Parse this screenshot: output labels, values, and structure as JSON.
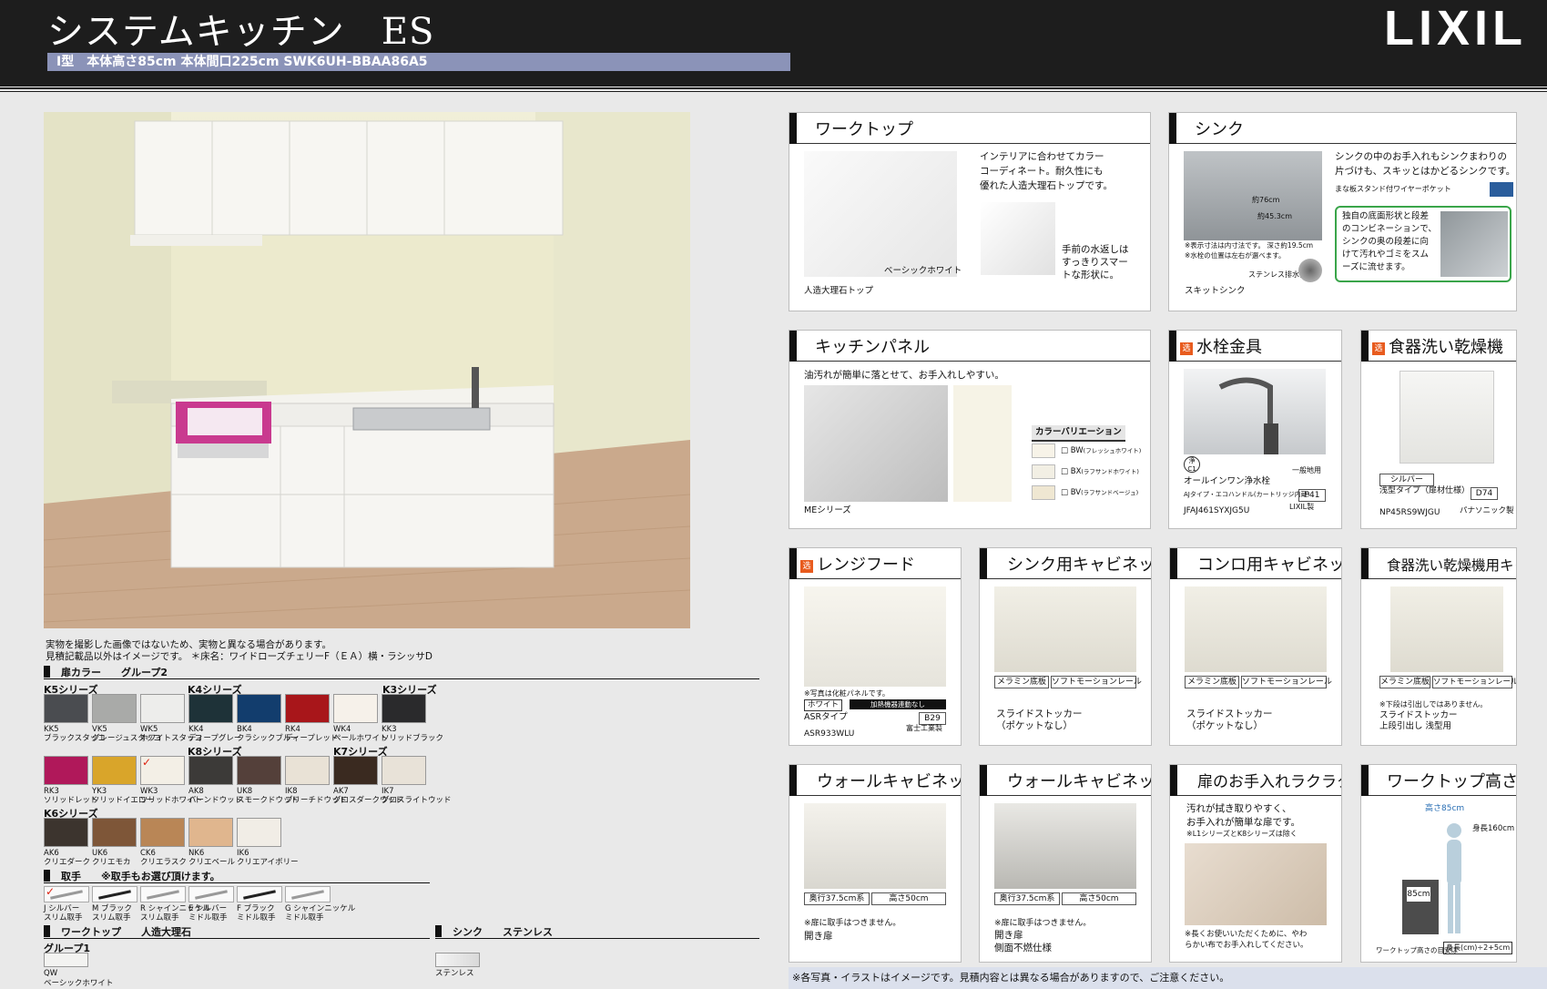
{
  "header": {
    "title_main": "システムキッチン",
    "title_series": "ES",
    "brand": "LIXIL",
    "spec": "Ⅰ型　本体高さ85cm 本体間口225cm SWK6UH-BBAA86A5"
  },
  "main_image": {
    "caption_1": "実物を撮影した画像ではないため、実物と異なる場合があります。",
    "caption_2": "見積記載品以外はイメージです。 ＊床名：ワイドローズチェリーF（ＥＡ）横・ラシッサD"
  },
  "door_color": {
    "label": "扉カラー",
    "group": "グループ2",
    "series_labels": {
      "k5": "K5シリーズ",
      "k4": "K4シリーズ",
      "k3": "K3シリーズ",
      "k8": "K8シリーズ",
      "k7": "K7シリーズ",
      "k6": "K6シリーズ"
    },
    "row1": [
      {
        "code": "KK5",
        "name": "ブラックスタッコ",
        "color": "#4a4c50"
      },
      {
        "code": "VK5",
        "name": "グレージュスタッコ",
        "color": "#a9aaa8"
      },
      {
        "code": "WK5",
        "name": "ホワイトスタッコ",
        "color": "#ededeb"
      },
      {
        "code": "KK4",
        "name": "ディープグレー",
        "color": "#1e3238"
      },
      {
        "code": "BK4",
        "name": "クラシックブルー",
        "color": "#123d6d"
      },
      {
        "code": "RK4",
        "name": "ディープレッド",
        "color": "#a8161a"
      },
      {
        "code": "WK4",
        "name": "ペールホワイト",
        "color": "#f6f1ea"
      },
      {
        "code": "KK3",
        "name": "ソリッドブラック",
        "color": "#2a2a2c"
      }
    ],
    "row2": [
      {
        "code": "RK3",
        "name": "ソリッドレッド",
        "color": "#b0185a"
      },
      {
        "code": "YK3",
        "name": "ソリッドイエロー",
        "color": "#d9a52a"
      },
      {
        "code": "WK3",
        "name": "ソリッドホワイト",
        "color": "#f3efe6"
      },
      {
        "code": "AK8",
        "name": "バーンドウッド",
        "color": "#3c3a38"
      },
      {
        "code": "UK8",
        "name": "スモークドウッド",
        "color": "#54403a"
      },
      {
        "code": "IK8",
        "name": "ブリーチドウッド",
        "color": "#e9e2d6"
      },
      {
        "code": "AK7",
        "name": "グロスダークウッド",
        "color": "#3a2a20"
      },
      {
        "code": "IK7",
        "name": "グロスライトウッド",
        "color": "#e8e2d8"
      }
    ],
    "row3": [
      {
        "code": "AK6",
        "name": "クリエダーク",
        "color": "#3c342e"
      },
      {
        "code": "UK6",
        "name": "クリエモカ",
        "color": "#7e5638"
      },
      {
        "code": "CK6",
        "name": "クリエラスク",
        "color": "#b98656"
      },
      {
        "code": "NK6",
        "name": "クリエベール",
        "color": "#e0b68e"
      },
      {
        "code": "IK6",
        "name": "クリエアイボリー",
        "color": "#f1ede6"
      }
    ]
  },
  "handle": {
    "label": "取手",
    "note": "※取手もお選び頂けます。",
    "items": [
      {
        "code": "J",
        "name1": "シルバー",
        "name2": "スリム取手"
      },
      {
        "code": "M",
        "name1": "ブラック",
        "name2": "スリム取手"
      },
      {
        "code": "R",
        "name1": "シャインニッケル",
        "name2": "スリム取手"
      },
      {
        "code": "E",
        "name1": "シルバー",
        "name2": "ミドル取手"
      },
      {
        "code": "F",
        "name1": "ブラック",
        "name2": "ミドル取手"
      },
      {
        "code": "G",
        "name1": "シャインニッケル",
        "name2": "ミドル取手"
      }
    ]
  },
  "worktop_sel": {
    "label": "ワークトップ",
    "material": "人造大理石",
    "group": "グループ1",
    "code": "QW",
    "name": "ベーシックホワイト"
  },
  "sink_sel": {
    "label": "シンク",
    "material": "ステンレス",
    "name": "ステンレス"
  },
  "cards": {
    "worktop": {
      "title": "ワークトップ",
      "desc": [
        "インテリアに合わせてカラー",
        "コーディネート。耐久性にも",
        "優れた人造大理石トップです。"
      ],
      "desc2": [
        "手前の水返しは",
        "すっきりスマー",
        "トな形状に。"
      ],
      "color_label": "ベーシックホワイト",
      "caption": "人造大理石トップ"
    },
    "sink": {
      "title": "シンク",
      "desc": [
        "シンクの中のお手入れもシンクまわりの",
        "片づけも、スキッとはかどるシンクです。"
      ],
      "stand": "まな板スタンド付ワイヤーポケット",
      "dim_w": "約76cm",
      "dim_d": "約45.3cm",
      "note1": "※表示寸法は内寸法です。 深さ約19.5cm",
      "note2": "※水栓の位置は左右が選べます。",
      "drain": "ステンレス排水口",
      "caption": "スキットシンク",
      "green": [
        "独自の底面形状と段差",
        "のコンビネーションで、",
        "シンクの奥の段差に向",
        "けて汚れやゴミをスム",
        "ーズに流せます。"
      ]
    },
    "panel": {
      "title": "キッチンパネル",
      "desc": "油汚れが簡単に落とせて、お手入れしやすい。",
      "variation": "カラーバリエーション",
      "colors": [
        {
          "code": "□ BW",
          "name": "(フレッシュホワイト)",
          "color": "#f7f3e8"
        },
        {
          "code": "□ BX",
          "name": "(ラフサンドホワイト)",
          "color": "#f2efe4"
        },
        {
          "code": "□ BV",
          "name": "(ラフサンドベージュ)",
          "color": "#efe7d2"
        }
      ],
      "caption": "MEシリーズ"
    },
    "faucet": {
      "title": "水栓金具",
      "badge": "浄",
      "badge_sub": "C1",
      "type": "一般地用",
      "name": "オールインワン浄水栓",
      "sub": "AJタイプ・エコハンドル(カートリッジ内蔵)",
      "page": "P41",
      "model": "JFAJ461SYXJG5U",
      "maker": "LIXIL製"
    },
    "dishwasher": {
      "title": "食器洗い乾燥機",
      "color": "シルバー",
      "type": "浅型タイプ（扉材仕様）",
      "page": "D74",
      "model": "NP45RS9WJGU",
      "maker": "パナソニック製"
    },
    "hood": {
      "title": "レンジフード",
      "note": "※写真は化粧パネルです。",
      "color": "ホワイト",
      "sub": "加熱機器連動なし",
      "type": "ASRタイプ",
      "page": "B29",
      "model": "ASR933WLU",
      "maker": "富士工業製"
    },
    "sink_cab": {
      "title": "シンク用キャビネット",
      "tag1": "メラミン底板",
      "tag2": "ソフトモーションレール",
      "line1": "スライドストッカー",
      "line2": "（ポケットなし）"
    },
    "stove_cab": {
      "title": "コンロ用キャビネット",
      "tag1": "メラミン底板",
      "tag2": "ソフトモーションレール",
      "line1": "スライドストッカー",
      "line2": "（ポケットなし）"
    },
    "dw_cab": {
      "title": "食器洗い乾燥機用キャビネット",
      "tag1": "メラミン底板",
      "tag2": "ソフトモーションレール",
      "note": "※下段は引出しではありません。",
      "line1": "スライドストッカー",
      "line2": "上段引出し 浅型用"
    },
    "wall_cab1": {
      "title": "ウォールキャビネット",
      "depth": "奥行37.5cm系",
      "height": "高さ50cm",
      "note": "※扉に取手はつきません。",
      "line1": "開き扉"
    },
    "wall_cab2": {
      "title": "ウォールキャビネット",
      "depth": "奥行37.5cm系",
      "height": "高さ50cm",
      "note": "※扉に取手はつきません。",
      "line1": "開き扉",
      "line2": "側面不燃仕様"
    },
    "door_care": {
      "title": "扉のお手入れラクラク",
      "desc1": "汚れが拭き取りやすく、",
      "desc2": "お手入れが簡単な扉です。",
      "desc3": "※L1シリーズとK8シリーズは除く",
      "note1": "※長くお使いいただくために、やわ",
      "note2": "らかい布でお手入れしてください。"
    },
    "height": {
      "title": "ワークトップ高さ",
      "value": "高さ85cm",
      "person": "身長160cm",
      "box": "85cm",
      "formula_label": "ワークトップ高さの目安は",
      "formula": "身長(cm)÷2+5cm"
    }
  },
  "footnote": "※各写真・イラストはイメージです。見積内容とは異なる場合がありますので、ご注意ください。"
}
